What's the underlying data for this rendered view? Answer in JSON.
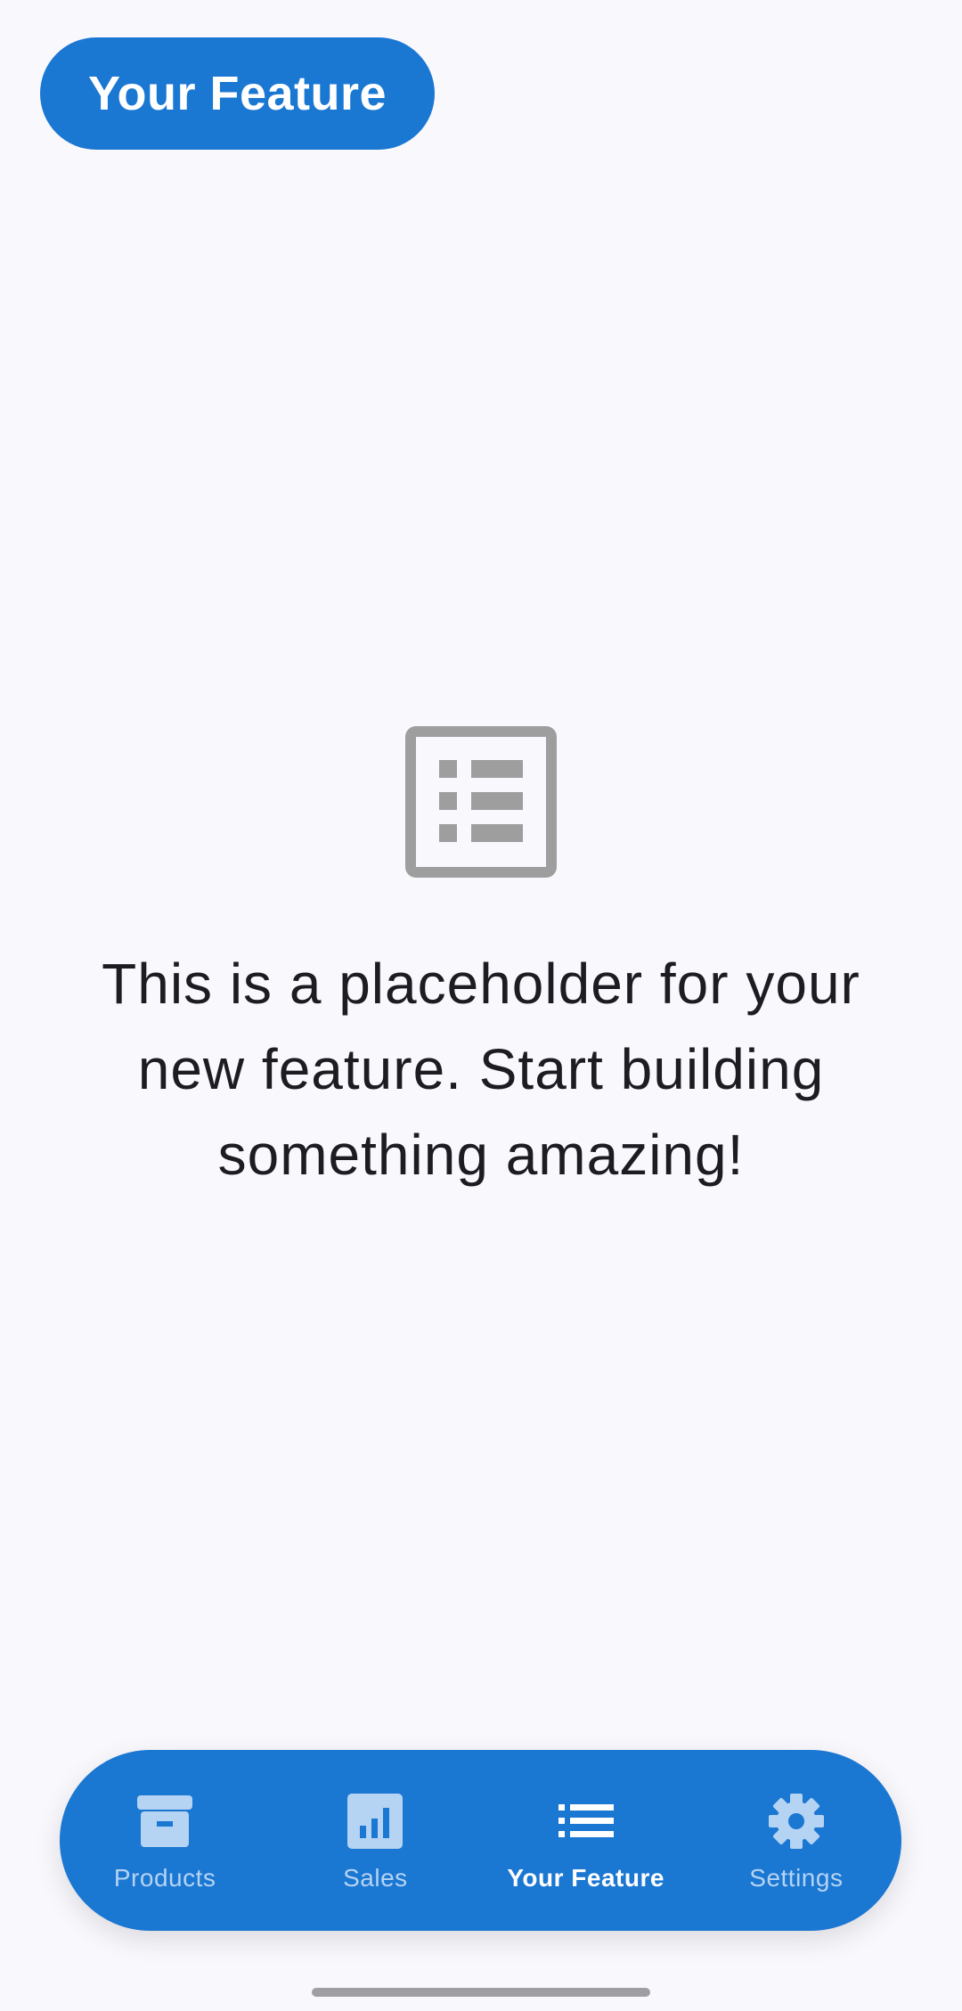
{
  "header": {
    "title": "Your Feature"
  },
  "main": {
    "icon": "list-alt-icon",
    "message": "This is a placeholder for your new feature. Start building something amazing!"
  },
  "bottom_nav": {
    "items": [
      {
        "label": "Products",
        "icon": "archive-icon",
        "active": false
      },
      {
        "label": "Sales",
        "icon": "bar-chart-icon",
        "active": false
      },
      {
        "label": "Your Feature",
        "icon": "list-icon",
        "active": true
      },
      {
        "label": "Settings",
        "icon": "gear-icon",
        "active": false
      }
    ]
  },
  "colors": {
    "primary": "#1a77d2",
    "background": "#f9f8fd",
    "inactive_nav": "#b5d3f3",
    "icon_gray": "#9e9e9e",
    "text": "#1c1c22"
  }
}
